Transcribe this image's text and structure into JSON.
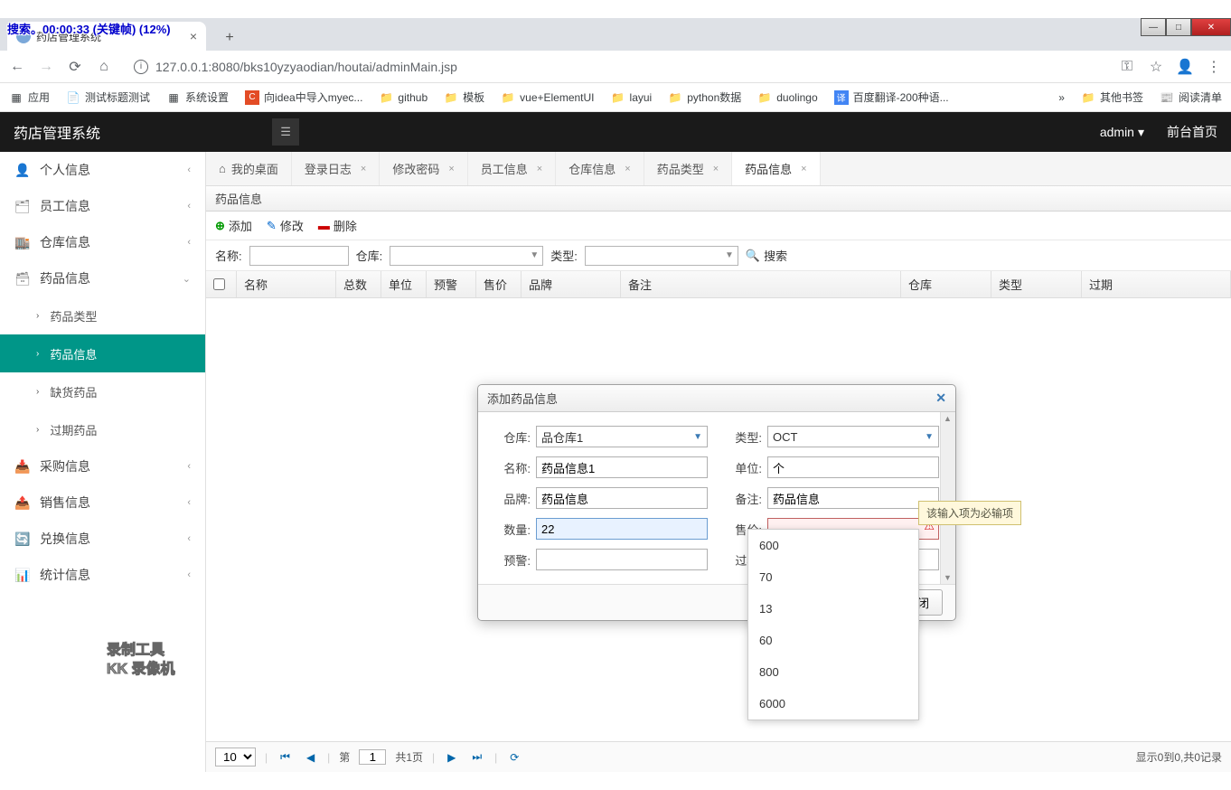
{
  "overlay": "搜索。00:00:33 (关键帧) (12%)",
  "window": {
    "minimize": "—",
    "maximize": "□",
    "close": "✕"
  },
  "browser": {
    "tab_title": "药店管理系统",
    "url": "127.0.0.1:8080/bks10yzyaodian/houtai/adminMain.jsp",
    "nav_icons": {
      "back": "←",
      "forward": "→",
      "reload": "⟳",
      "home": "⌂"
    },
    "right_icons": {
      "key": "⚿",
      "star": "☆",
      "profile": "👤",
      "menu": "⋮"
    },
    "bookmarks": [
      {
        "icon": "▦",
        "label": "应用"
      },
      {
        "icon": "📄",
        "label": "测试标题测试"
      },
      {
        "icon": "▦",
        "label": "系统设置"
      },
      {
        "icon": "C",
        "label": "向idea中导入myec..."
      },
      {
        "icon": "📁",
        "label": "github"
      },
      {
        "icon": "📁",
        "label": "模板"
      },
      {
        "icon": "📁",
        "label": "vue+ElementUI"
      },
      {
        "icon": "📁",
        "label": "layui"
      },
      {
        "icon": "📁",
        "label": "python数据"
      },
      {
        "icon": "📁",
        "label": "duolingo"
      },
      {
        "icon": "译",
        "label": "百度翻译-200种语..."
      }
    ],
    "bm_more": "»",
    "bm_other": "其他书签",
    "bm_reading": "阅读清单"
  },
  "header": {
    "title": "药店管理系统",
    "menu_icon": "☰",
    "user": "admin",
    "home": "前台首页"
  },
  "sidebar": {
    "items": [
      {
        "icon": "👤",
        "label": "个人信息",
        "chev": "‹"
      },
      {
        "icon": "🗂",
        "label": "员工信息",
        "chev": "‹"
      },
      {
        "icon": "🏬",
        "label": "仓库信息",
        "chev": "‹"
      },
      {
        "icon": "🗃",
        "label": "药品信息",
        "chev": "⌄",
        "expanded": true
      },
      {
        "icon": "📥",
        "label": "采购信息",
        "chev": "‹"
      },
      {
        "icon": "📤",
        "label": "销售信息",
        "chev": "‹"
      },
      {
        "icon": "🔄",
        "label": "兑换信息",
        "chev": "‹"
      },
      {
        "icon": "📊",
        "label": "统计信息",
        "chev": "‹"
      }
    ],
    "sub": [
      {
        "label": "药品类型"
      },
      {
        "label": "药品信息",
        "active": true
      },
      {
        "label": "缺货药品"
      },
      {
        "label": "过期药品"
      }
    ]
  },
  "tabs": [
    {
      "icon": "⌂",
      "label": "我的桌面",
      "close": false
    },
    {
      "label": "登录日志",
      "close": true
    },
    {
      "label": "修改密码",
      "close": true
    },
    {
      "label": "员工信息",
      "close": true
    },
    {
      "label": "仓库信息",
      "close": true
    },
    {
      "label": "药品类型",
      "close": true
    },
    {
      "label": "药品信息",
      "close": true,
      "active": true
    }
  ],
  "panel": {
    "title": "药品信息",
    "add": "添加",
    "edit": "修改",
    "delete": "删除"
  },
  "search": {
    "name_label": "名称:",
    "wh_label": "仓库:",
    "type_label": "类型:",
    "btn": "搜索"
  },
  "columns": [
    "",
    "名称",
    "总数",
    "单位",
    "预警",
    "售价",
    "品牌",
    "备注",
    "仓库",
    "类型",
    "过期"
  ],
  "dialog": {
    "title": "添加药品信息",
    "fields": {
      "wh": {
        "label": "仓库:",
        "value": "品仓库1"
      },
      "type": {
        "label": "类型:",
        "value": "OCT"
      },
      "name": {
        "label": "名称:",
        "value": "药品信息1"
      },
      "unit": {
        "label": "单位:",
        "value": "个"
      },
      "brand": {
        "label": "品牌:",
        "value": "药品信息"
      },
      "remark": {
        "label": "备注:",
        "value": "药品信息"
      },
      "qty": {
        "label": "数量:",
        "value": "22"
      },
      "price": {
        "label": "售价:",
        "value": ""
      },
      "warn": {
        "label": "预警:",
        "value": ""
      },
      "expire": {
        "label": "过期:",
        "value": ""
      }
    },
    "close_btn": "关闭"
  },
  "tooltip": "该输入项为必输项",
  "dropdown": [
    "600",
    "70",
    "13",
    "60",
    "800",
    "6000"
  ],
  "pagination": {
    "size": "10",
    "page_label_prefix": "第",
    "page": "1",
    "total_pages": "共1页",
    "info": "显示0到0,共0记录"
  },
  "watermark": {
    "line1": "录制工具",
    "line2": "KK 录像机"
  }
}
